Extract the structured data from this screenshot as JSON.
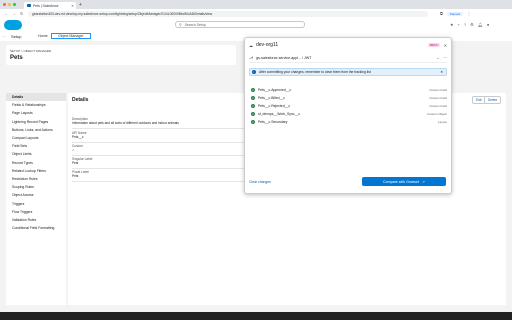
{
  "browser": {
    "tab_title": "Pets | Salesforce",
    "url": "gearstation403-dev-ed.develop.my.salesforce-setup.com/lightning/setup/ObjectManager/01I4L00000Bbc9lUAB/Details/view",
    "profile_label": "Paused"
  },
  "salesforce": {
    "search_placeholder": "Search Setup",
    "app_name": "Setup",
    "nav_home": "Home",
    "nav_object_manager": "Object Manager",
    "breadcrumb": "SETUP > OBJECT MANAGER",
    "page_title": "Pets",
    "section_title": "Details",
    "edit_label": "Edit",
    "delete_label": "Delete",
    "sidebar": [
      "Details",
      "Fields & Relationships",
      "Page Layouts",
      "Lightning Record Pages",
      "Buttons, Links, and Actions",
      "Compact Layouts",
      "Field Sets",
      "Object Limits",
      "Record Types",
      "Related Lookup Filters",
      "Restriction Rules",
      "Scoping Rules",
      "Object Access",
      "Triggers",
      "Flow Triggers",
      "Validation Rules",
      "Conditional Field Formatting"
    ],
    "details": {
      "description_label": "Description",
      "description_value": "Information about pets and all sorts of different outdoors and indoor animals",
      "api_name_label": "API Name",
      "api_name_value": "Pets__c",
      "custom_label": "Custom",
      "custom_value": "✓",
      "singular_label": "Singular Label",
      "singular_value": "Pets",
      "plural_label": "Plural Label",
      "plural_value": "Pets"
    }
  },
  "popup": {
    "org": "dev-org11",
    "badge": "BETA",
    "branch": "gs-salesforce-service-appl... / JWT",
    "banner": "After committing your changes, remember to clear them from the tracking list",
    "changes": [
      {
        "name": "Pets__c.Approved__c",
        "type": "Custom Field"
      },
      {
        "name": "Pets__c.Billed__c",
        "type": "Custom Field"
      },
      {
        "name": "Pets__c.Rejected__c",
        "type": "Custom Field"
      },
      {
        "name": "sf_devops__Work_Sync__c",
        "type": "Custom Object"
      },
      {
        "name": "Pets__c.Secondary",
        "type": "Layout"
      }
    ],
    "clear_label": "Clear changes",
    "compare_label": "Compare with Gearset"
  }
}
